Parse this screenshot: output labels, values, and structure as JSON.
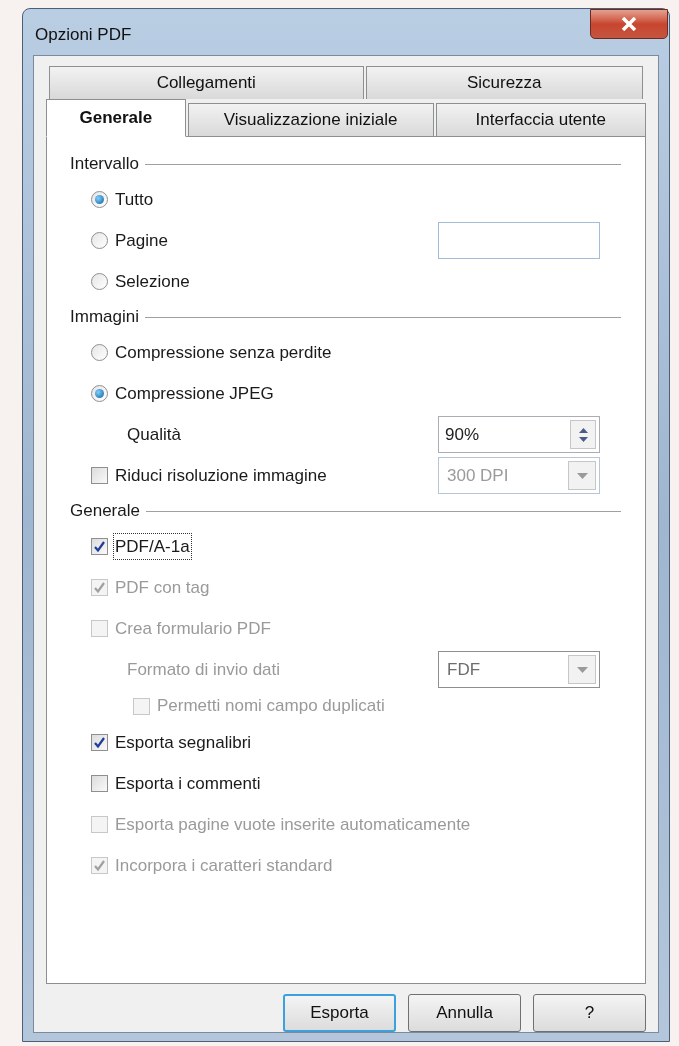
{
  "window": {
    "title": "Opzioni PDF"
  },
  "tabs": [
    [
      {
        "label": "Collegamenti",
        "selected": false
      },
      {
        "label": "Sicurezza",
        "selected": false
      }
    ],
    [
      {
        "label": "Generale",
        "selected": true
      },
      {
        "label": "Visualizzazione iniziale",
        "selected": false
      },
      {
        "label": "Interfaccia utente",
        "selected": false
      }
    ]
  ],
  "sections": [
    {
      "title": "Intervallo",
      "items": [
        {
          "kind": "radio",
          "label": "Tutto",
          "selected": true,
          "disabled": false
        },
        {
          "kind": "radio",
          "label": "Pagine",
          "selected": false,
          "disabled": false,
          "field": {
            "kind": "text",
            "disabled": false
          }
        },
        {
          "kind": "radio",
          "label": "Selezione",
          "selected": false,
          "disabled": false
        }
      ]
    },
    {
      "title": "Immagini",
      "items": [
        {
          "kind": "radio",
          "label": "Compressione senza perdite",
          "selected": false,
          "disabled": false
        },
        {
          "kind": "radio",
          "label": "Compressione JPEG",
          "selected": true,
          "disabled": false,
          "children": [
            {
              "kind": "label",
              "label": "Qualità",
              "disabled": false,
              "field": {
                "kind": "spin",
                "value": "90%",
                "disabled": false
              }
            }
          ]
        },
        {
          "kind": "checkbox",
          "label": "Riduci risoluzione immagine",
          "checked": false,
          "disabled": false,
          "field": {
            "kind": "dropdown",
            "value": "300 DPI",
            "disabled": true
          }
        }
      ]
    },
    {
      "title": "Generale",
      "items": [
        {
          "kind": "checkbox",
          "label": "PDF/A-1a",
          "checked": true,
          "disabled": false,
          "focused": true
        },
        {
          "kind": "checkbox",
          "label": "PDF con tag",
          "checked": true,
          "disabled": true
        },
        {
          "kind": "checkbox",
          "label": "Crea formulario PDF",
          "checked": false,
          "disabled": true,
          "children": [
            {
              "kind": "label",
              "label": "Formato di invio dati",
              "disabled": true,
              "field": {
                "kind": "dropdown",
                "value": "FDF",
                "disabled": false
              }
            },
            {
              "kind": "checkbox",
              "label": "Permetti nomi campo duplicati",
              "checked": false,
              "disabled": true
            }
          ]
        },
        {
          "kind": "checkbox",
          "label": "Esporta segnalibri",
          "checked": true,
          "disabled": false
        },
        {
          "kind": "checkbox",
          "label": "Esporta i commenti",
          "checked": false,
          "disabled": false
        },
        {
          "kind": "checkbox",
          "label": "Esporta pagine vuote inserite automaticamente",
          "checked": false,
          "disabled": true
        },
        {
          "kind": "checkbox",
          "label": "Incorpora i caratteri standard",
          "checked": true,
          "disabled": true
        }
      ]
    }
  ],
  "buttons": [
    {
      "label": "Esporta",
      "default": true
    },
    {
      "label": "Annulla",
      "default": false
    },
    {
      "label": "?",
      "default": false
    }
  ]
}
